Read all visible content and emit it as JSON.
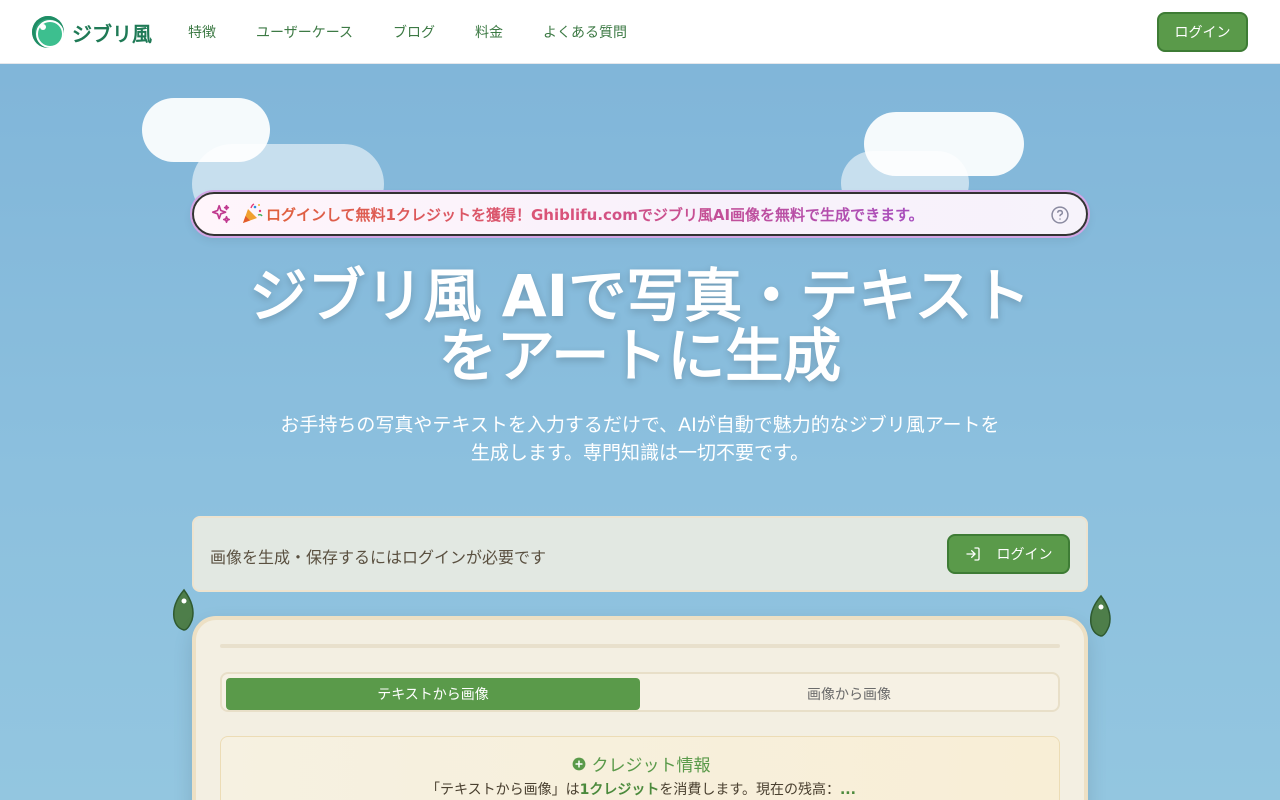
{
  "header": {
    "brand": "ジブリ風",
    "nav": [
      {
        "label": "特徴"
      },
      {
        "label": "ユーザーケース"
      },
      {
        "label": "ブログ"
      },
      {
        "label": "料金"
      },
      {
        "label": "よくある質問"
      }
    ],
    "login_label": "ログイン"
  },
  "announcement": {
    "text": "ログインして無料1クレジットを獲得！Ghiblifu.comでジブリ風AI画像を無料で生成できます。"
  },
  "hero": {
    "title_line1": "ジブリ風 AIで写真・テキスト",
    "title_line2": "をアートに生成",
    "subtitle_line1": "お手持ちの写真やテキストを入力するだけで、AIが自動で魅力的なジブリ風アートを",
    "subtitle_line2": "生成します。専門知識は一切不要です。"
  },
  "login_notice": {
    "text": "画像を生成・保存するにはログインが必要です",
    "button_label": "ログイン"
  },
  "generator": {
    "tabs": [
      {
        "label": "テキストから画像",
        "active": true
      },
      {
        "label": "画像から画像",
        "active": false
      }
    ],
    "credit": {
      "title": "クレジット情報",
      "desc_prefix": "「テキストから画像」は",
      "desc_cost": "1クレジット",
      "desc_suffix": "を消費します。現在の残高：",
      "balance": "..."
    }
  },
  "colors": {
    "accent_green": "#5a9a4a",
    "sky": "#7fb4d8",
    "brand_teal": "#1f7a56"
  }
}
